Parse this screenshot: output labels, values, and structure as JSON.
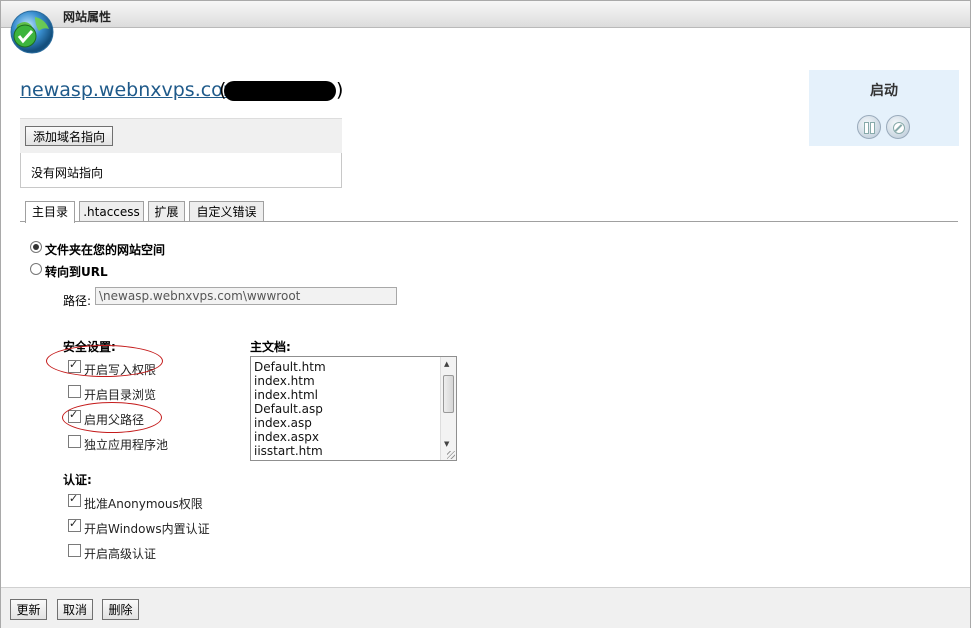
{
  "window": {
    "title": "网站属性",
    "icon": "globe-icon"
  },
  "site": {
    "domain": "newasp.webnxvps.com",
    "open_paren": "(",
    "close_paren": ")"
  },
  "status": {
    "label": "启动",
    "pause_icon": "pause-icon",
    "stop_icon": "stop-icon"
  },
  "domain_pointers": {
    "add_button": "添加域名指向",
    "empty_text": "没有网站指向"
  },
  "tabs": [
    {
      "label": "主目录",
      "active": true
    },
    {
      "label": ".htaccess",
      "active": false
    },
    {
      "label": "扩展",
      "active": false
    },
    {
      "label": "自定义错误",
      "active": false
    }
  ],
  "home_dir": {
    "option_folder": "文件夹在您的网站空间",
    "option_url": "转向到URL",
    "selected": "folder",
    "path_label": "路径:",
    "path_value": "\\newasp.webnxvps.com\\wwwroot"
  },
  "security": {
    "title": "安全设置:",
    "items": [
      {
        "label": "开启写入权限",
        "checked": true
      },
      {
        "label": "开启目录浏览",
        "checked": false
      },
      {
        "label": "启用父路径",
        "checked": true
      },
      {
        "label": "独立应用程序池",
        "checked": false
      }
    ]
  },
  "auth": {
    "title": "认证:",
    "items": [
      {
        "label": "批准Anonymous权限",
        "checked": true
      },
      {
        "label": "开启Windows内置认证",
        "checked": true
      },
      {
        "label": "开启高级认证",
        "checked": false
      }
    ]
  },
  "default_docs": {
    "title": "主文档:",
    "items": [
      "Default.htm",
      "index.htm",
      "index.html",
      "Default.asp",
      "index.asp",
      "index.aspx",
      "iisstart.htm"
    ]
  },
  "footer": {
    "update": "更新",
    "cancel": "取消",
    "delete": "删除"
  },
  "colors": {
    "link": "#1f5a8a",
    "status_bg": "#e5f1fb",
    "annotation_oval": "#c41b1b"
  }
}
